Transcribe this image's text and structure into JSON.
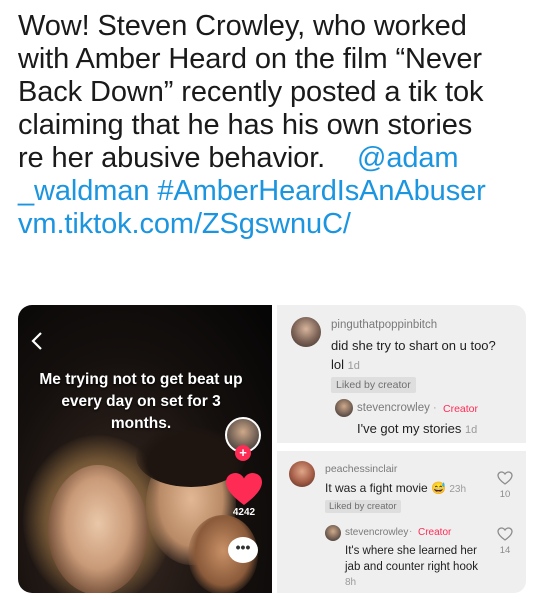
{
  "tweet": {
    "line1": "Wow! Steven Crowley, who worked",
    "line2": "with Amber Heard on the film “Never",
    "line3": "Back Down” recently posted a tik tok",
    "line4": "claiming that he has his own stories",
    "line5_text": "re her abusive behavior.",
    "line5_link": "@adam",
    "line6_link": "_waldman",
    "line6_hashtag": "#AmberHeardIsAnAbuser",
    "line7_link": "vm.tiktok.com/ZSgswnuC/"
  },
  "video": {
    "back_icon": "chevron-left-icon",
    "caption_line1": "Me trying not to get beat up",
    "caption_line2": "every day on set for 3",
    "caption_line3": "months.",
    "follow_icon": "plus-icon",
    "like_icon": "heart-icon",
    "like_count": "4242",
    "comment_icon": "comment-icon",
    "comment_glyph": "•••",
    "accent_color": "#fe2c55"
  },
  "comment1": {
    "username": "pinguthatpoppinbitch",
    "text_line1": "did she try to shart on u too?",
    "text_line2": "lol",
    "time": "1d",
    "liked_badge": "Liked by creator",
    "reply": {
      "username": "stevencrowley",
      "separator": "·",
      "creator_label": "Creator",
      "text": "I've got my stories",
      "time": "1d"
    }
  },
  "comment2": {
    "username": "peachessinclair",
    "text": "It was a fight movie",
    "emoji": "😅",
    "time": "23h",
    "likes": "10",
    "liked_badge": "Liked by creator",
    "reply": {
      "username": "stevencrowley",
      "separator": "·",
      "creator_label": "Creator",
      "text_line1": "It's where she learned her",
      "text_line2": "jab and counter right hook",
      "time": "8h",
      "likes": "14"
    }
  }
}
